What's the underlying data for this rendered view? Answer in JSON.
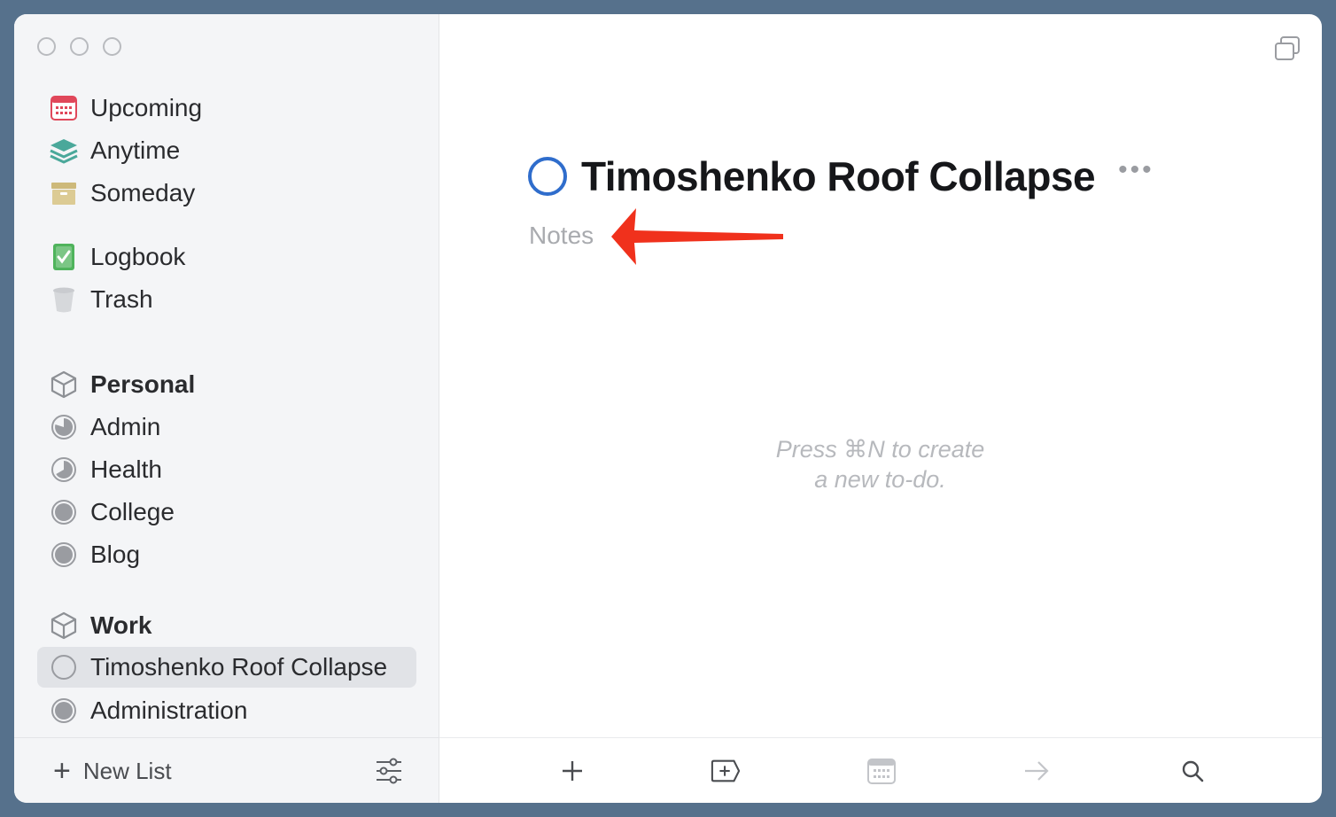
{
  "sidebar": {
    "smart_lists": [
      {
        "label": "Upcoming",
        "icon": "calendar-icon"
      },
      {
        "label": "Anytime",
        "icon": "layers-icon"
      },
      {
        "label": "Someday",
        "icon": "archive-box-icon"
      },
      {
        "label": "Logbook",
        "icon": "checkmark-book-icon"
      },
      {
        "label": "Trash",
        "icon": "trash-icon"
      }
    ],
    "areas": [
      {
        "label": "Personal",
        "projects": [
          "Admin",
          "Health",
          "College",
          "Blog"
        ]
      },
      {
        "label": "Work",
        "projects": [
          "Timoshenko Roof Collapse",
          "Administration"
        ]
      }
    ],
    "footer": {
      "new_list_label": "New List"
    }
  },
  "main": {
    "project_title": "Timoshenko Roof Collapse",
    "more_label": "•••",
    "notes_placeholder": "Notes",
    "empty_hint_line1": "Press ⌘N to create",
    "empty_hint_line2": "a new to-do."
  },
  "colors": {
    "accent_blue": "#2f6dcc",
    "annotation_arrow": "#f0311c",
    "upcoming_red": "#e0475a",
    "anytime_teal": "#4aa89a",
    "someday_tan": "#cdb97a",
    "logbook_green": "#4fb35c"
  }
}
